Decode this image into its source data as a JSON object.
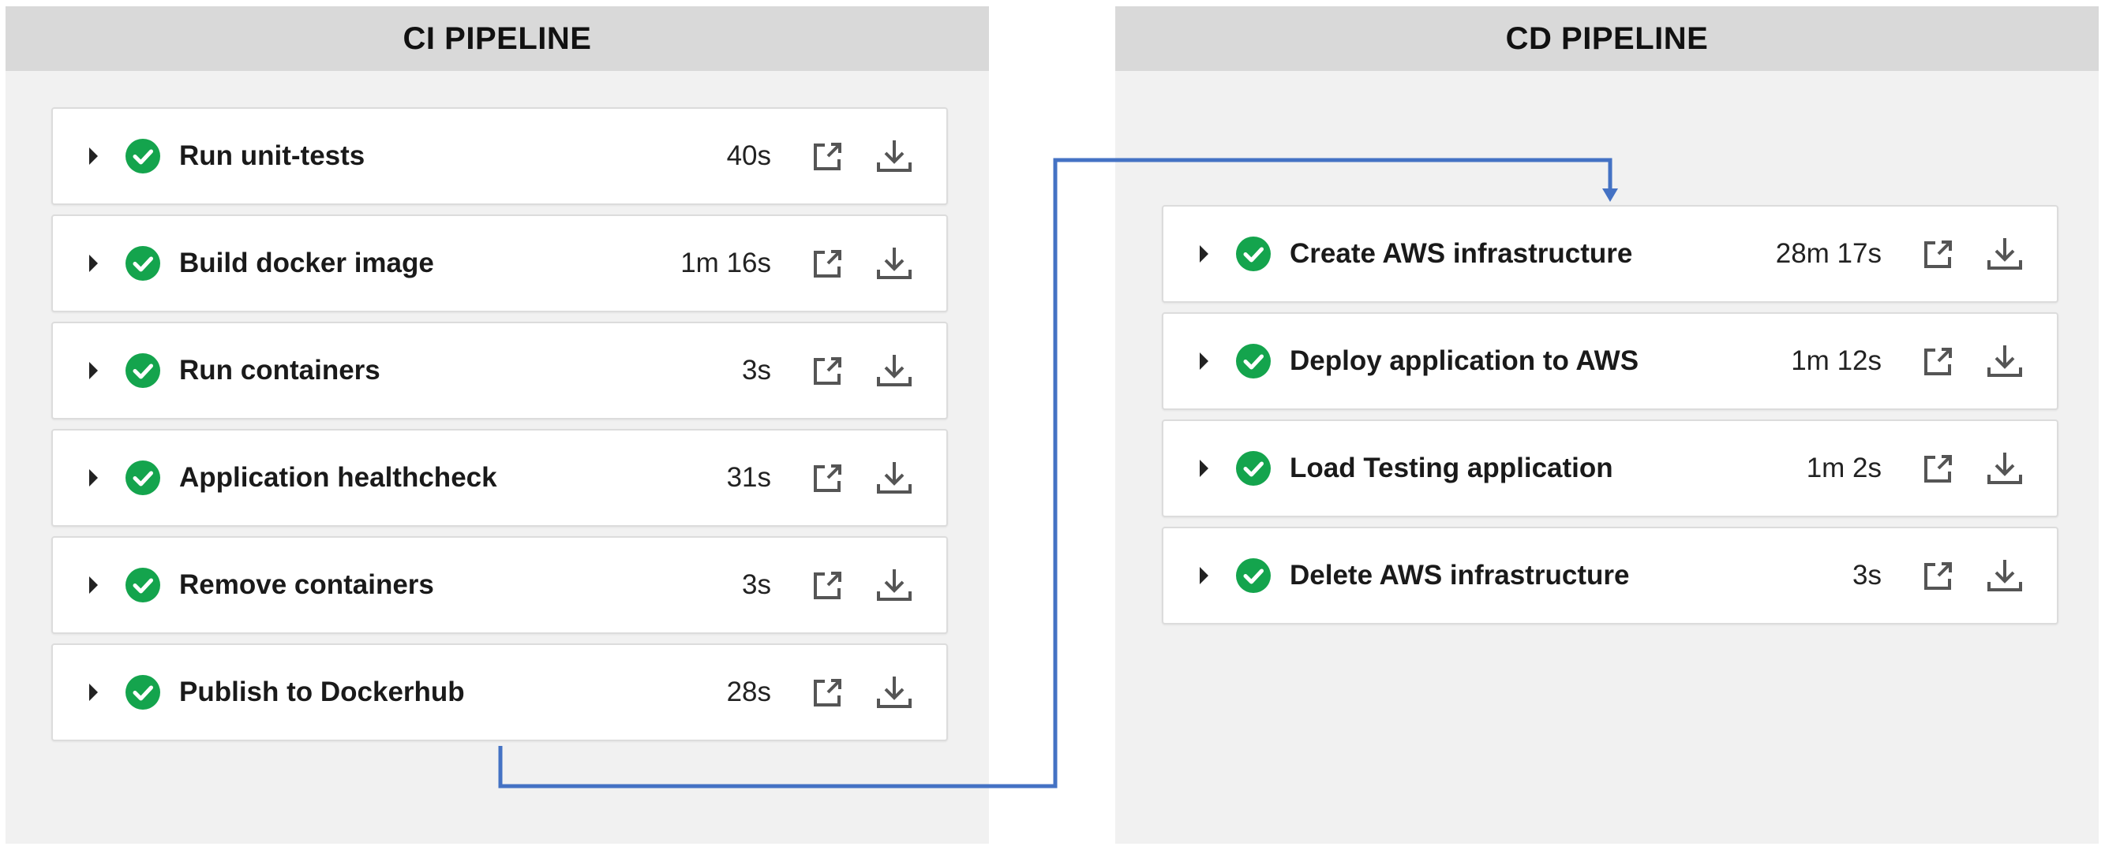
{
  "ci_pipeline": {
    "title": "CI PIPELINE",
    "jobs": [
      {
        "name": "Run unit-tests",
        "duration": "40s",
        "status": "success"
      },
      {
        "name": "Build docker image",
        "duration": "1m 16s",
        "status": "success"
      },
      {
        "name": "Run containers",
        "duration": "3s",
        "status": "success"
      },
      {
        "name": "Application healthcheck",
        "duration": "31s",
        "status": "success"
      },
      {
        "name": "Remove containers",
        "duration": "3s",
        "status": "success"
      },
      {
        "name": "Publish to Dockerhub",
        "duration": "28s",
        "status": "success"
      }
    ]
  },
  "cd_pipeline": {
    "title": "CD PIPELINE",
    "jobs": [
      {
        "name": "Create AWS infrastructure",
        "duration": "28m 17s",
        "status": "success"
      },
      {
        "name": "Deploy application to AWS",
        "duration": "1m 12s",
        "status": "success"
      },
      {
        "name": "Load Testing application",
        "duration": "1m 2s",
        "status": "success"
      },
      {
        "name": "Delete AWS infrastructure",
        "duration": "3s",
        "status": "success"
      }
    ]
  },
  "icons": {
    "expand": "caret-right-icon",
    "status": "check-circle-icon",
    "open": "external-link-icon",
    "download": "download-icon"
  },
  "colors": {
    "success": "#14a44d",
    "connector": "#4472c4",
    "header_bg": "#d9d9d9",
    "panel_bg": "#f1f1f1"
  }
}
